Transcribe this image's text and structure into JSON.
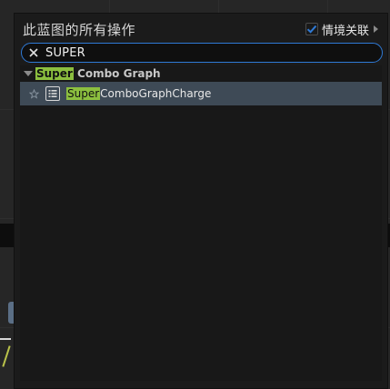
{
  "panel": {
    "title": "此蓝图的所有操作",
    "context_sensitive_label": "情境关联",
    "context_sensitive_checked": true
  },
  "search": {
    "value": "SUPER"
  },
  "results": {
    "category": {
      "highlight": "Super",
      "rest": " Combo Graph"
    },
    "items": [
      {
        "highlight": "Super",
        "rest": "ComboGraphCharge",
        "icon": "function-icon"
      }
    ]
  },
  "colors": {
    "highlight": "#8cbf3f",
    "selected_row": "#3e4a56",
    "search_border": "#2f7ad6",
    "checkbox_tick": "#2f7ad6"
  }
}
